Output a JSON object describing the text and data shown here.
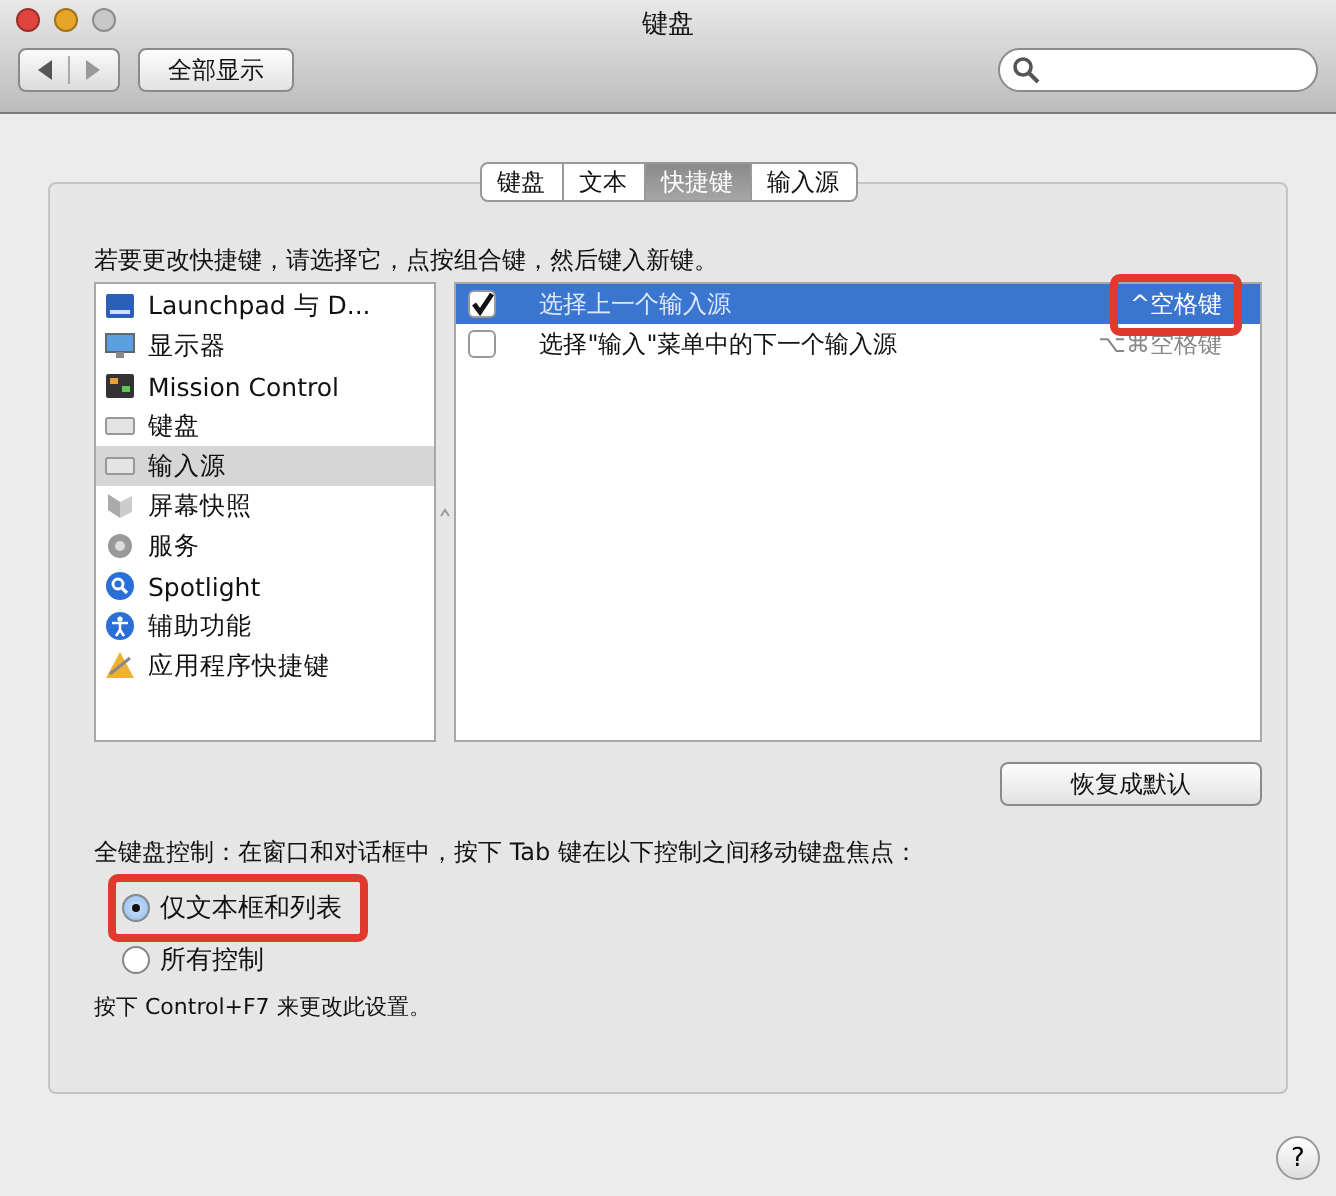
{
  "window": {
    "title": "键盘"
  },
  "toolbar": {
    "show_all": "全部显示"
  },
  "tabs": [
    {
      "label": "键盘",
      "selected": false
    },
    {
      "label": "文本",
      "selected": false
    },
    {
      "label": "快捷键",
      "selected": true
    },
    {
      "label": "输入源",
      "selected": false
    }
  ],
  "instruction": "若要更改快捷键，请选择它，点按组合键，然后键入新键。",
  "categories": [
    {
      "label": "Launchpad 与 D...",
      "selected": false
    },
    {
      "label": "显示器",
      "selected": false
    },
    {
      "label": "Mission Control",
      "selected": false
    },
    {
      "label": "键盘",
      "selected": false
    },
    {
      "label": "输入源",
      "selected": true
    },
    {
      "label": "屏幕快照",
      "selected": false
    },
    {
      "label": "服务",
      "selected": false
    },
    {
      "label": "Spotlight",
      "selected": false
    },
    {
      "label": "辅助功能",
      "selected": false
    },
    {
      "label": "应用程序快捷键",
      "selected": false
    }
  ],
  "shortcuts": [
    {
      "label": "选择上一个输入源",
      "key": "^空格键",
      "checked": true,
      "selected": true,
      "highlighted": true
    },
    {
      "label": "选择\"输入\"菜单中的下一个输入源",
      "key": "⌥⌘空格键",
      "checked": false,
      "selected": false,
      "highlighted": false
    }
  ],
  "restore_button": "恢复成默认",
  "full_keyboard": {
    "label": "全键盘控制：在窗口和对话框中，按下 Tab 键在以下控制之间移动键盘焦点：",
    "options": [
      {
        "label": "仅文本框和列表",
        "selected": true,
        "highlighted": true
      },
      {
        "label": "所有控制",
        "selected": false,
        "highlighted": false
      }
    ],
    "note": "按下 Control+F7 来更改此设置。"
  },
  "help": "?"
}
